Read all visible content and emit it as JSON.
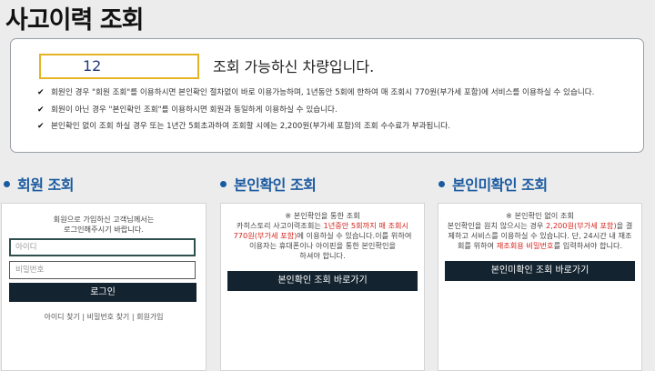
{
  "page": {
    "title": "사고이력 조회"
  },
  "info": {
    "car_count": "12",
    "lookup_text": "조회 가능하신 차량입니다.",
    "notices": [
      "회원인 경우 \"회원 조회\"를 이용하시면 본인확인 절차없이 바로 이용가능하며, 1년동안 5회에 한하여 매 조회시 770원(부가세 포함)에 서비스를 이용하실 수 있습니다.",
      "회원이 아닌 경우 \"본인확인 조회\"를 이용하시면 회원과 동일하게 이용하실 수 있습니다.",
      "본인확인 없이 조회 하실 경우 또는 1년간 5회초과하여 조회할 시에는 2,200원(부가세 포함)의 조회 수수료가 부과됩니다."
    ],
    "check_icon": "check-icon"
  },
  "member": {
    "title": "회원 조회",
    "intro_line1": "회원으로 가입하신 고객님께서는",
    "intro_line2": "로그인해주시기 바랍니다.",
    "id_placeholder": "아이디",
    "password_placeholder": "비밀번호",
    "login_label": "로그인",
    "find_id": "아이디 찾기",
    "find_password": "비밀번호 찾기",
    "signup": "회원가입",
    "separator": "|"
  },
  "verify": {
    "title": "본인확인 조회",
    "heading": "※ 본인확인을 통한 조회",
    "line1_a": "카히스토리 사고이력조회는 ",
    "line1_red": "1년중안 5회까지 매 조회시",
    "line2_red": "770원(부가세 포함)",
    "line2_b": "에 이용하실 수 있습니다.이를 위하여",
    "line3": "이용자는 휴대폰이나 아이핀을 통한 본인확인을",
    "line4": "하셔야 합니다.",
    "button_label": "본인확인 조회 바로가기"
  },
  "noverify": {
    "title": "본인미확인 조회",
    "heading": "※ 본인확인 없이 조회",
    "line1_a": "본인확인을 원치 않으시는 경우 ",
    "line1_red": "2,200원(부가세 포함)",
    "line1_b": "을 결",
    "line2": "제하고 서비스를 이용하실 수 있습니다. 단, 24시간 내 재조",
    "line3_a": "회를 위하여 ",
    "line3_red": "재조회용 비밀번호",
    "line3_b": "를 입력하셔야 합니다.",
    "button_label": "본인미확인 조회 바로가기"
  },
  "colors": {
    "accent": "#1a5aa0",
    "button": "#13232f",
    "highlight_border": "#e6b422",
    "warning": "#d4241c"
  }
}
